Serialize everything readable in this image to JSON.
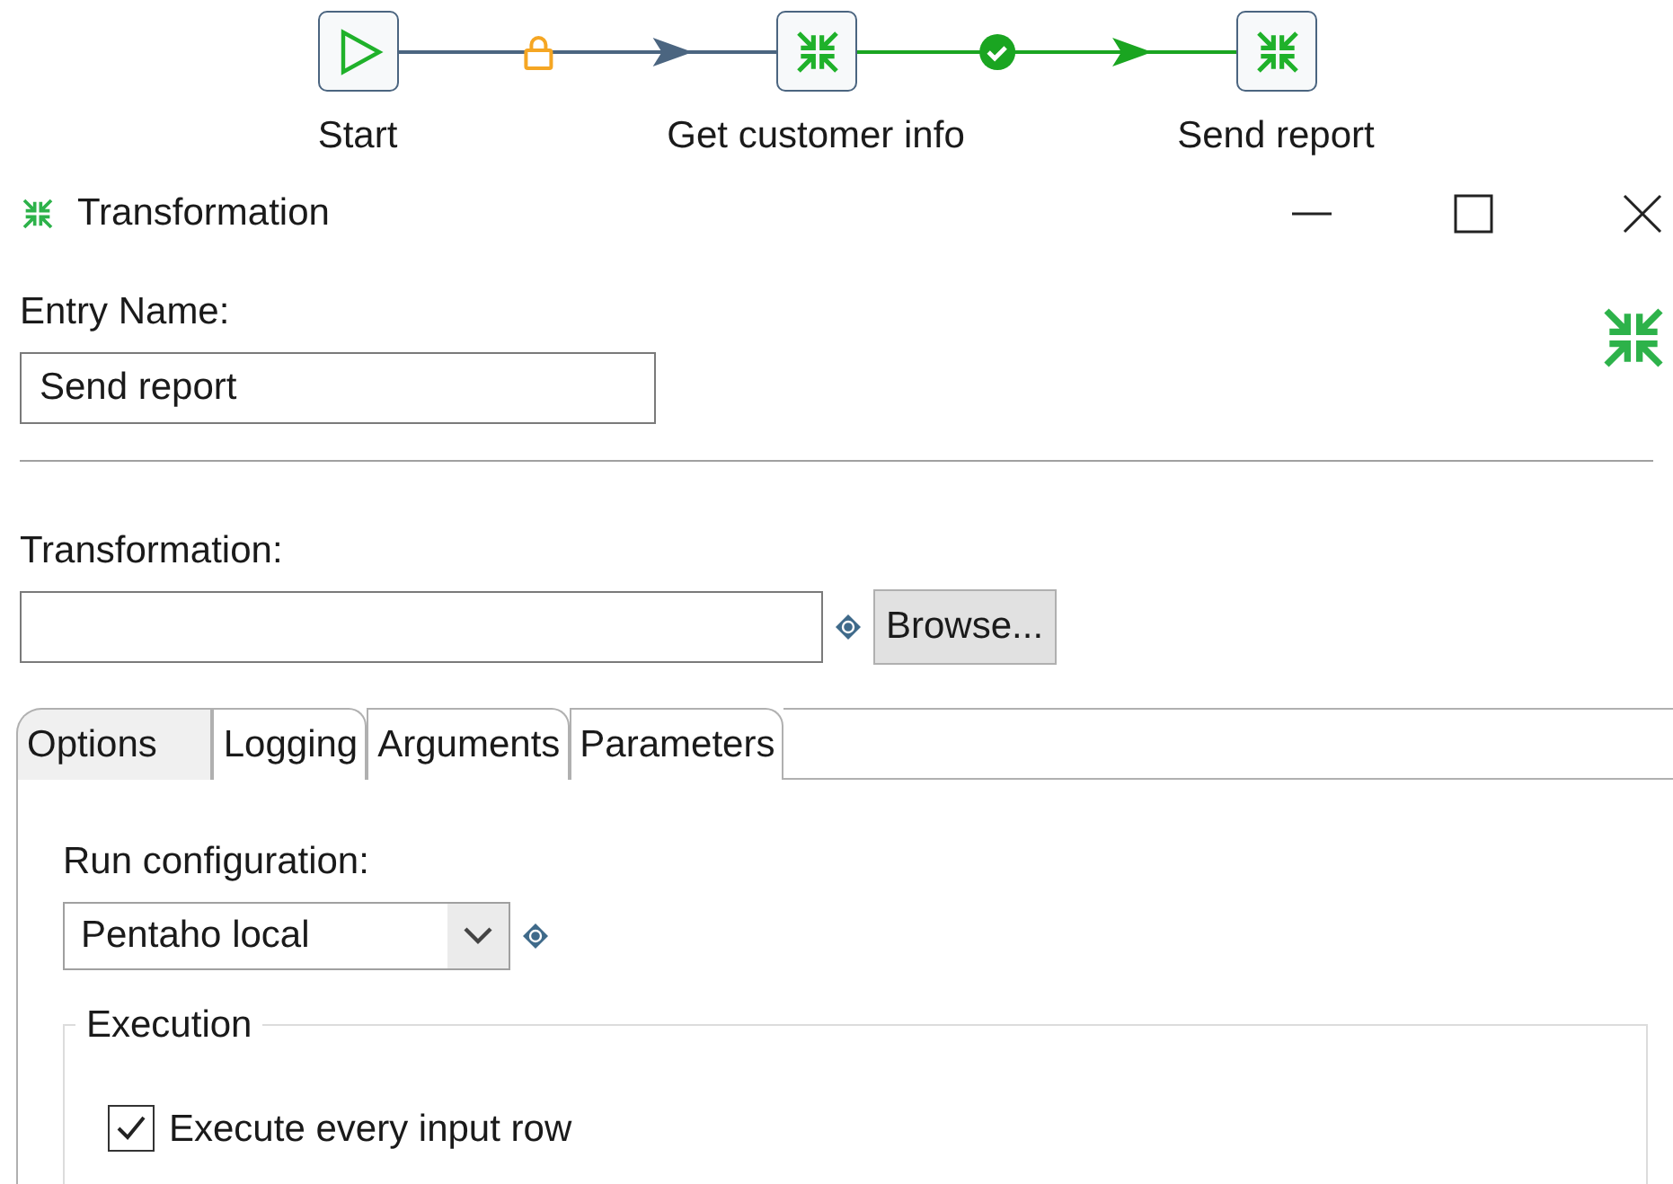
{
  "diagram": {
    "nodes": [
      {
        "label": "Start",
        "kind": "start"
      },
      {
        "label": "Get customer info",
        "kind": "transformation"
      },
      {
        "label": "Send report",
        "kind": "transformation"
      }
    ],
    "hops": [
      {
        "kind": "locked",
        "color": "#4b6580"
      },
      {
        "kind": "success",
        "color": "#1aa521"
      }
    ]
  },
  "window": {
    "title": "Transformation"
  },
  "entry_name": {
    "label": "Entry Name:",
    "value": "Send report"
  },
  "transformation": {
    "label": "Transformation:",
    "button": "Browse..."
  },
  "tabs": [
    {
      "label": "Options",
      "selected": true
    },
    {
      "label": "Logging",
      "selected": false
    },
    {
      "label": "Arguments",
      "selected": false
    },
    {
      "label": "Parameters",
      "selected": false
    }
  ],
  "options": {
    "run_configuration": {
      "label": "Run configuration:",
      "value": "Pentaho local"
    },
    "execution": {
      "legend": "Execution",
      "checkbox": {
        "label": "Execute every input row",
        "checked": true
      }
    }
  }
}
